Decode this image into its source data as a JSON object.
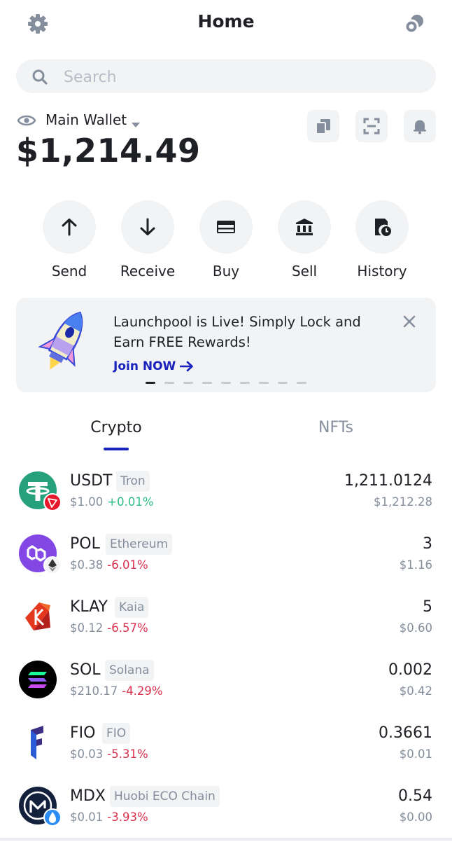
{
  "header": {
    "title": "Home",
    "settings_icon": "gear-icon",
    "connect_icon": "coins-icon"
  },
  "search": {
    "placeholder": "Search"
  },
  "wallet": {
    "name": "Main Wallet",
    "balance": "$1,214.49"
  },
  "actions": [
    {
      "label": "Send",
      "icon": "arrow-up-icon"
    },
    {
      "label": "Receive",
      "icon": "arrow-down-icon"
    },
    {
      "label": "Buy",
      "icon": "card-icon"
    },
    {
      "label": "Sell",
      "icon": "bank-icon"
    },
    {
      "label": "History",
      "icon": "history-icon"
    }
  ],
  "banner": {
    "text": "Launchpool is Live! Simply Lock and Earn FREE Rewards!",
    "cta": "Join NOW",
    "page_count": 9,
    "active_page": 1
  },
  "tabs": [
    {
      "label": "Crypto",
      "active": true
    },
    {
      "label": "NFTs",
      "active": false
    }
  ],
  "tokens": [
    {
      "symbol": "USDT",
      "chain": "Tron",
      "price": "$1.00",
      "change": "+0.01%",
      "direction": "up",
      "amount": "1,211.0124",
      "value": "$1,212.28",
      "color": "#26a17b",
      "badge_color": "#e5192b"
    },
    {
      "symbol": "POL",
      "chain": "Ethereum",
      "price": "$0.38",
      "change": "-6.01%",
      "direction": "down",
      "amount": "3",
      "value": "$1.16",
      "color": "#8247e5",
      "badge_color": "#f2f3f5"
    },
    {
      "symbol": "KLAY",
      "chain": "Kaia",
      "price": "$0.12",
      "change": "-6.57%",
      "direction": "down",
      "amount": "5",
      "value": "$0.60",
      "color": "#e4381e"
    },
    {
      "symbol": "SOL",
      "chain": "Solana",
      "price": "$210.17",
      "change": "-4.29%",
      "direction": "down",
      "amount": "0.002",
      "value": "$0.42",
      "color": "#000000"
    },
    {
      "symbol": "FIO",
      "chain": "FIO",
      "price": "$0.03",
      "change": "-5.31%",
      "direction": "down",
      "amount": "0.3661",
      "value": "$0.01",
      "color": "#3c2f86"
    },
    {
      "symbol": "MDX",
      "chain": "Huobi ECO Chain",
      "price": "$0.01",
      "change": "-3.93%",
      "direction": "down",
      "amount": "0.54",
      "value": "$0.00",
      "color": "#14213d",
      "badge_color": "#2a8cf4"
    }
  ]
}
